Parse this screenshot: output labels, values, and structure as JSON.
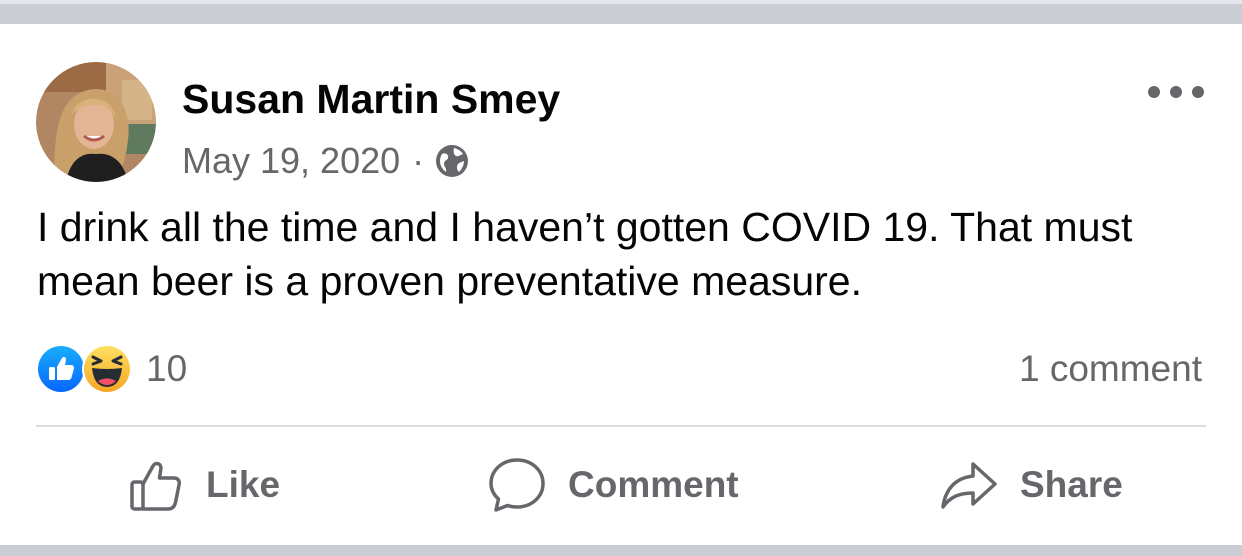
{
  "post": {
    "author_name": "Susan Martin Smey",
    "date": "May 19, 2020",
    "separator": "·",
    "audience_icon": "globe-icon",
    "text": "I drink all the time and I haven’t gotten COVID 19. That must mean beer is a proven preventative measure."
  },
  "reactions": {
    "icons": [
      "like-icon",
      "haha-icon"
    ],
    "count": "10",
    "comments": "1 comment"
  },
  "actions": {
    "like_label": "Like",
    "comment_label": "Comment",
    "share_label": "Share"
  },
  "colors": {
    "text_primary": "#050505",
    "text_secondary": "#65676b",
    "like_blue": "#1877f2",
    "haha_yellow": "#f7b928",
    "band_gray": "#cacdd3"
  }
}
